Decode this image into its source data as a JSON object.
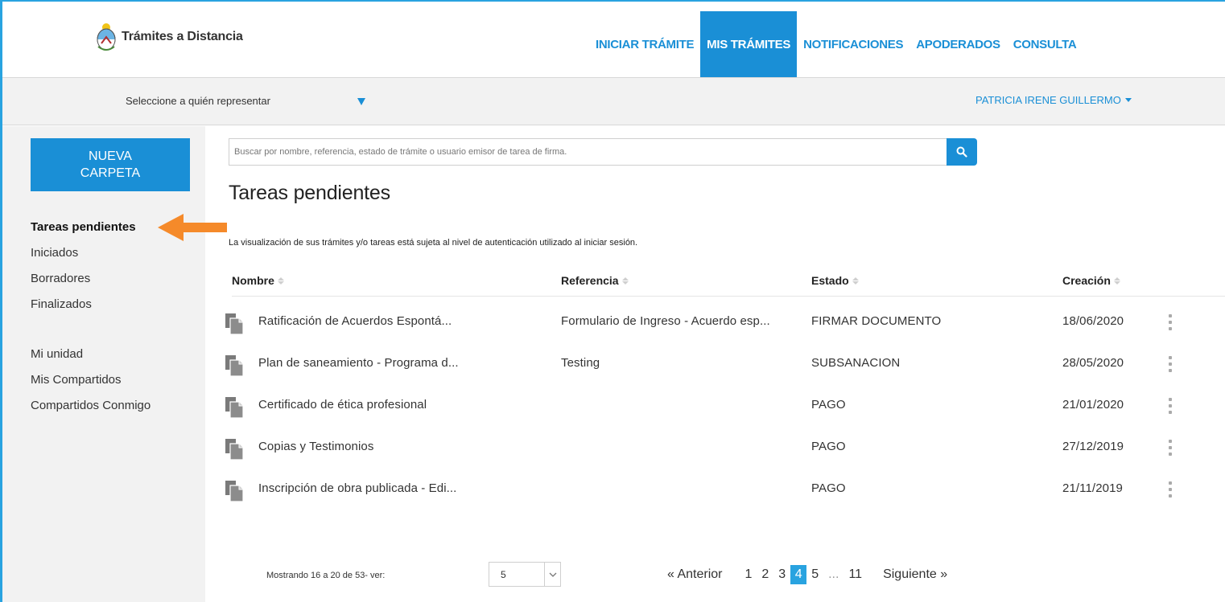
{
  "app": {
    "title": "Trámites a Distancia"
  },
  "nav": {
    "items": [
      {
        "label": "INICIAR TRÁMITE",
        "active": false
      },
      {
        "label": "MIS TRÁMITES",
        "active": true
      },
      {
        "label": "NOTIFICACIONES",
        "active": false
      },
      {
        "label": "APODERADOS",
        "active": false
      },
      {
        "label": "CONSULTA",
        "active": false
      }
    ]
  },
  "subbar": {
    "represent_label": "Seleccione a quién representar",
    "user_name": "PATRICIA IRENE GUILLERMO"
  },
  "sidebar": {
    "new_folder": "NUEVA CARPETA",
    "items": [
      {
        "label": "Tareas pendientes",
        "active": true
      },
      {
        "label": "Iniciados",
        "active": false
      },
      {
        "label": "Borradores",
        "active": false
      },
      {
        "label": "Finalizados",
        "active": false
      },
      {
        "label": "Mi unidad",
        "active": false
      },
      {
        "label": "Mis Compartidos",
        "active": false
      },
      {
        "label": "Compartidos Conmigo",
        "active": false
      }
    ]
  },
  "search": {
    "placeholder": "Buscar por nombre, referencia, estado de trámite o usuario emisor de tarea de firma.",
    "icon": "search-icon"
  },
  "main": {
    "title": "Tareas pendientes",
    "notice": "La visualización de sus trámites y/o tareas está sujeta al nivel de autenticación utilizado al iniciar sesión."
  },
  "table": {
    "columns": [
      "Nombre",
      "Referencia",
      "Estado",
      "Creación"
    ],
    "rows": [
      {
        "nombre": "Ratificación de Acuerdos Espontá...",
        "referencia": "Formulario de Ingreso - Acuerdo esp...",
        "estado": "FIRMAR DOCUMENTO",
        "creacion": "18/06/2020"
      },
      {
        "nombre": "Plan de saneamiento - Programa d...",
        "referencia": "Testing",
        "estado": "SUBSANACION",
        "creacion": "28/05/2020"
      },
      {
        "nombre": "Certificado de ética profesional",
        "referencia": "",
        "estado": "PAGO",
        "creacion": "21/01/2020"
      },
      {
        "nombre": "Copias y Testimonios",
        "referencia": "",
        "estado": "PAGO",
        "creacion": "27/12/2019"
      },
      {
        "nombre": "Inscripción de obra publicada - Edi...",
        "referencia": "",
        "estado": "PAGO",
        "creacion": "21/11/2019"
      }
    ]
  },
  "pagination": {
    "showing": "Mostrando 16 a 20 de 53- ver:",
    "per_page": "5",
    "prev": "« Anterior",
    "next": "Siguiente »",
    "pages": [
      "1",
      "2",
      "3",
      "4",
      "5",
      "...",
      "11"
    ],
    "current": "4"
  },
  "colors": {
    "accent": "#1a8fd6",
    "frame": "#29a3e0",
    "sidebar_bg": "#f2f2f2",
    "arrow": "#f58a2a"
  }
}
